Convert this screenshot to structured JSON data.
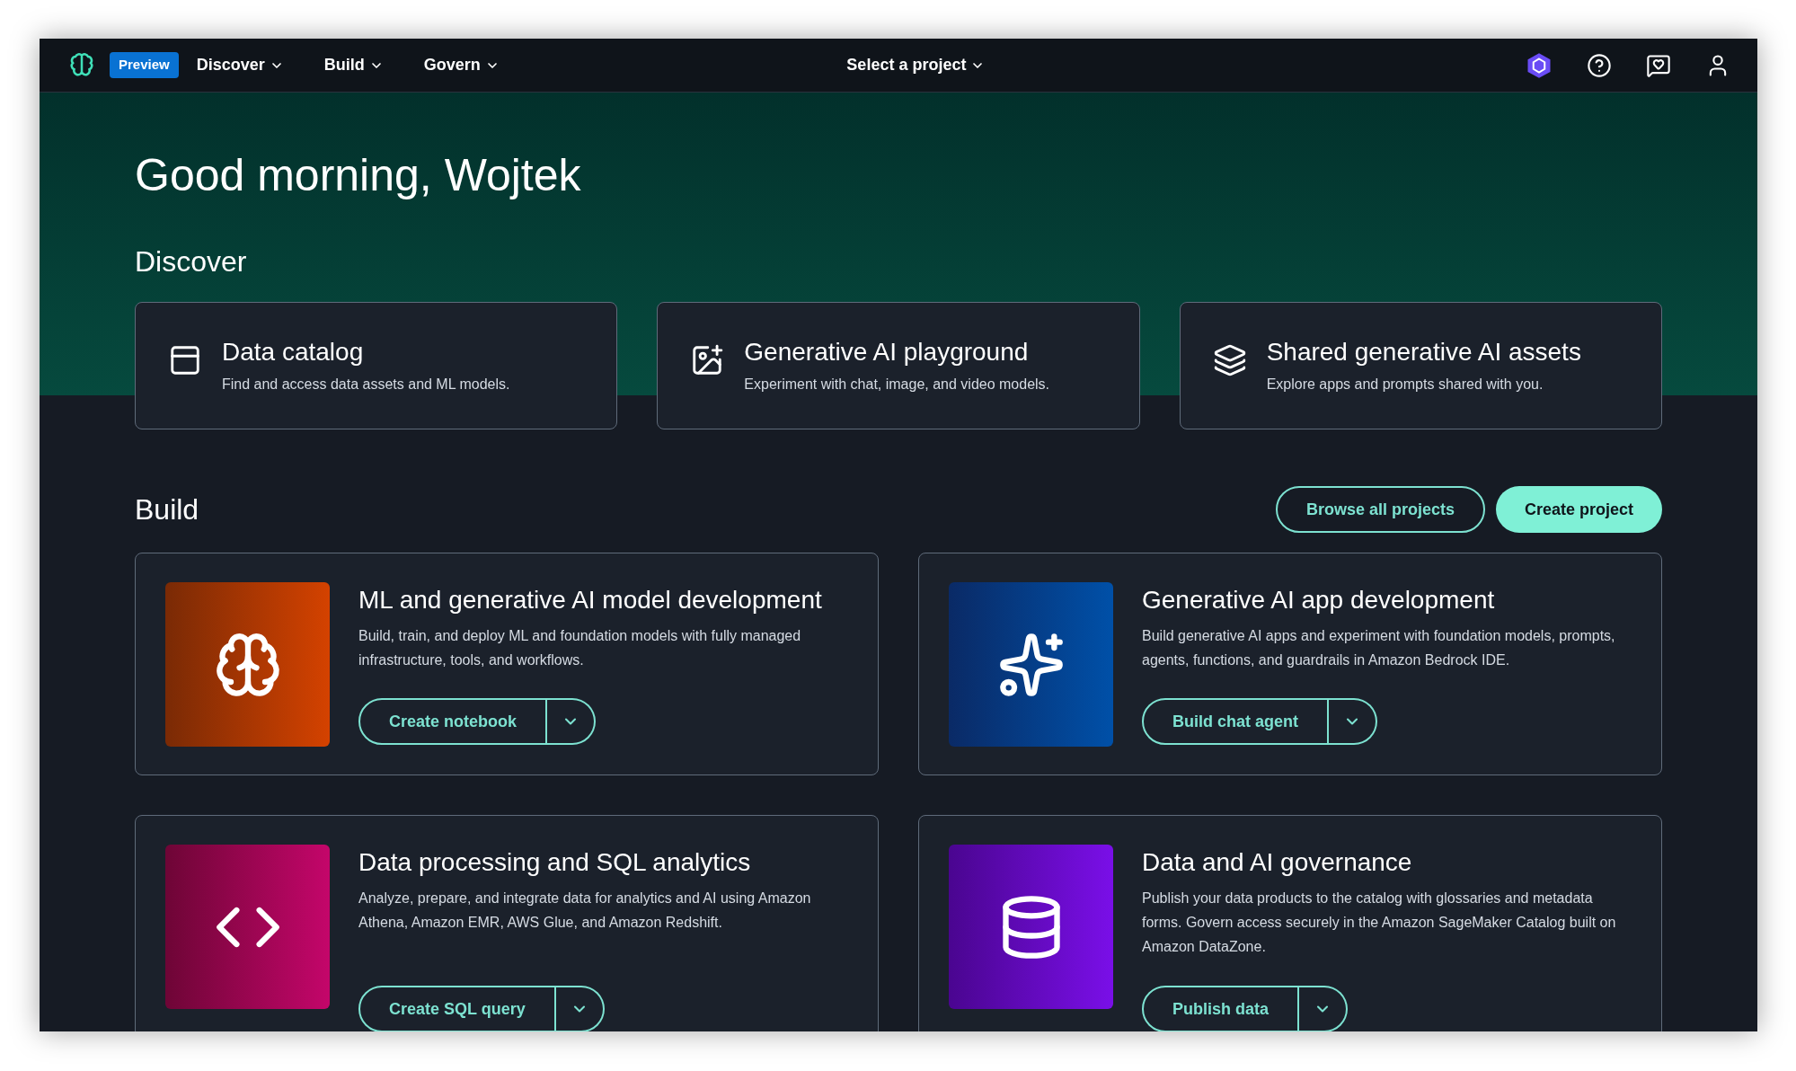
{
  "nav": {
    "badge": "Preview",
    "menus": [
      "Discover",
      "Build",
      "Govern"
    ],
    "project_select": "Select a project"
  },
  "greeting": "Good morning, Wojtek",
  "discover": {
    "heading": "Discover",
    "cards": [
      {
        "title": "Data catalog",
        "description": "Find and access data assets and ML models."
      },
      {
        "title": "Generative AI playground",
        "description": "Experiment with chat, image, and video models."
      },
      {
        "title": "Shared generative AI assets",
        "description": "Explore apps and prompts shared with you."
      }
    ]
  },
  "build": {
    "heading": "Build",
    "buttons": [
      "Browse all projects",
      "Create project"
    ],
    "cards": [
      {
        "title": "ML and generative AI model development",
        "description": "Build, train, and deploy ML and foundation models with fully managed infrastructure, tools, and workflows.",
        "action": "Create notebook"
      },
      {
        "title": "Generative AI app development",
        "description": "Build generative AI apps and experiment with foundation models, prompts, agents, functions, and guardrails in Amazon Bedrock IDE.",
        "action": "Build chat agent"
      },
      {
        "title": "Data processing and SQL analytics",
        "description": "Analyze, prepare, and integrate data for analytics and AI using Amazon Athena, Amazon EMR, AWS Glue, and Amazon Redshift.",
        "action": "Create SQL query"
      },
      {
        "title": "Data and AI governance",
        "description": "Publish your data products to the catalog with glossaries and metadata forms. Govern access securely in the Amazon SageMaker Catalog built on Amazon DataZone.",
        "action": "Publish data"
      }
    ]
  }
}
